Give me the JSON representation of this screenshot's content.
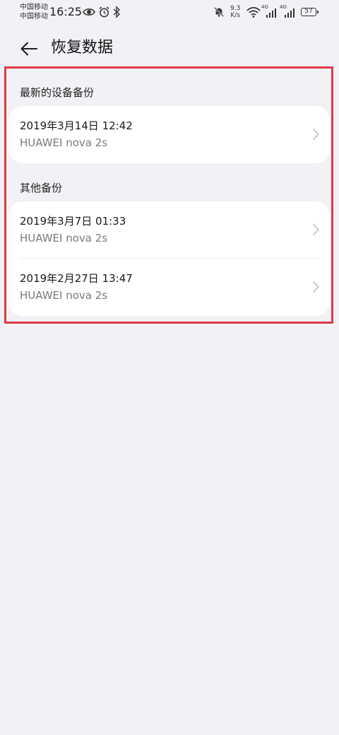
{
  "status_bar": {
    "carrier1": "中国移动",
    "carrier2": "中国移动",
    "time": "16:25",
    "net_speed_value": "9.3",
    "net_speed_unit": "K/s",
    "signal1_label": "4G",
    "signal2_label": "4G",
    "battery": "57",
    "icons": [
      "eye-icon",
      "alarm-icon",
      "bluetooth-icon",
      "mute-bell-icon",
      "wifi-icon",
      "signal-icon",
      "signal-icon",
      "battery-icon"
    ]
  },
  "header": {
    "back_icon": "back-arrow-icon",
    "title": "恢复数据"
  },
  "highlight_color": "#e03a48",
  "latest_section": {
    "title": "最新的设备备份",
    "items": [
      {
        "date": "2019年3月14日 12:42",
        "device": "HUAWEI nova 2s"
      }
    ]
  },
  "other_section": {
    "title": "其他备份",
    "items": [
      {
        "date": "2019年3月7日 01:33",
        "device": "HUAWEI nova 2s"
      },
      {
        "date": "2019年2月27日 13:47",
        "device": "HUAWEI nova 2s"
      }
    ]
  }
}
